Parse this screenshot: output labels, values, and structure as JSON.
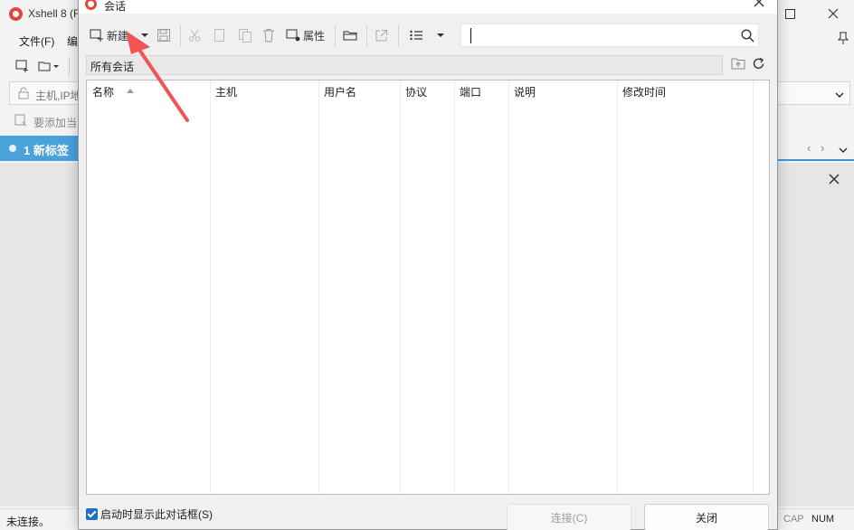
{
  "main": {
    "title": "Xshell 8 (F",
    "menu": [
      "文件(F)",
      "编"
    ],
    "address_placeholder": "主机,IP地",
    "hint": "要添加当",
    "tab_label": "1 新标签",
    "status": "未连接。",
    "cap": "CAP",
    "num": "NUM"
  },
  "dialog": {
    "title": "会话",
    "toolbar": {
      "new_label": "新建",
      "properties_label": "属性"
    },
    "search_value": "",
    "path_label": "所有会话",
    "columns": [
      "名称",
      "主机",
      "用户名",
      "协议",
      "端口",
      "说明",
      "修改时间"
    ],
    "show_on_start_label": "启动时显示此对话框(S)",
    "connect_label": "连接(C)",
    "close_label": "关闭"
  },
  "colors": {
    "tab_accent": "#49a2dc",
    "checkbox": "#1f6fc5",
    "annotation_arrow": "#f05454"
  }
}
